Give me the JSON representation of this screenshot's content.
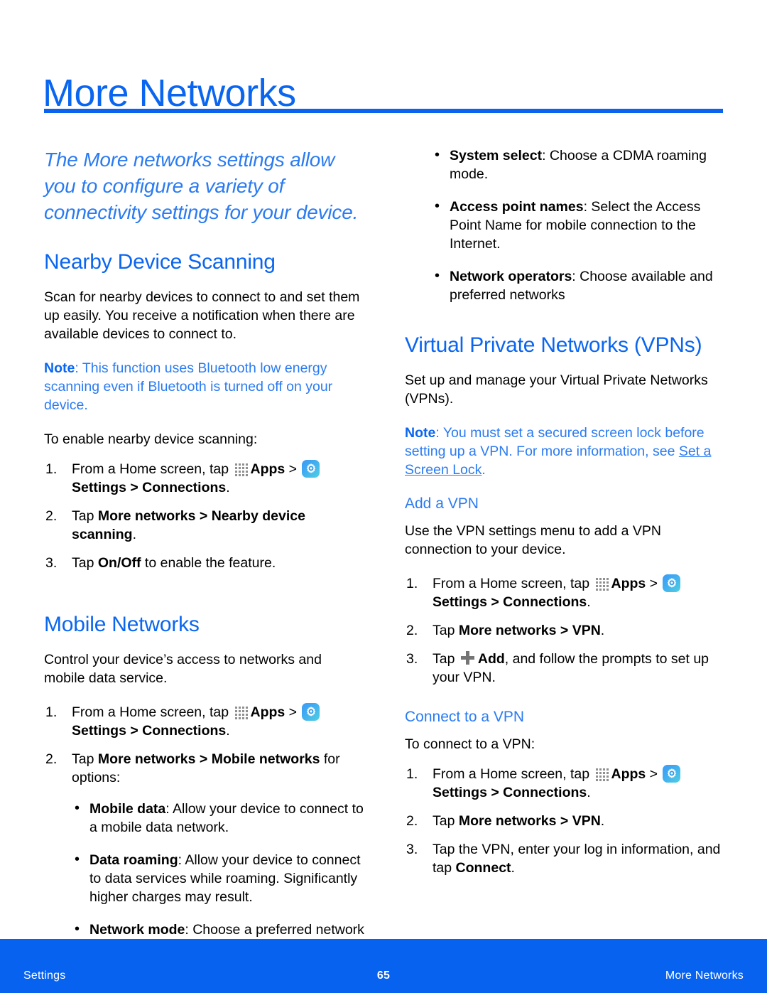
{
  "page": {
    "title": "More Networks",
    "accent_color": "#0a66f0",
    "note_color": "#2a7bf2",
    "footer_color": "#0862f0"
  },
  "intro": "The More networks settings allow you to configure a variety of connectivity settings for your device.",
  "left_column": {
    "nearby": {
      "heading": "Nearby Device Scanning",
      "body": "Scan for nearby devices to connect to and set them up easily. You receive a notification when there are available devices to connect to.",
      "note_label": "Note",
      "note_text": ": This function uses Bluetooth low energy scanning even if Bluetooth is turned off on your device.",
      "lead_in": "To enable nearby device scanning:",
      "steps": [
        {
          "pre": "From a Home screen, tap ",
          "apps": "Apps",
          "sep": " > ",
          "settings": "Settings",
          "post_bold": " > Connections",
          "post": "."
        },
        {
          "pre": "Tap ",
          "bold1": "More networks > Nearby device scanning",
          "post": "."
        },
        {
          "pre": "Tap ",
          "bold1": "On/Off",
          "post": " to enable the feature."
        }
      ]
    },
    "mobile": {
      "heading": "Mobile Networks",
      "body": "Control your device’s access to networks and mobile data service.",
      "steps": [
        {
          "pre": "From a Home screen, tap ",
          "apps": "Apps",
          "sep": " > ",
          "settings": "Settings",
          "post_bold": " > Connections",
          "post": "."
        },
        {
          "pre": "Tap ",
          "bold1": "More networks > Mobile networks",
          "post": " for options:"
        }
      ],
      "options": [
        {
          "term": "Mobile data",
          "desc": ": Allow your device to connect to a mobile data network."
        },
        {
          "term": "Data roaming",
          "desc": ": Allow your device to connect to data services while roaming. Significantly higher charges may result."
        },
        {
          "term": "Network mode",
          "desc": ": Choose a preferred network mode."
        }
      ]
    }
  },
  "right_column": {
    "continued_options": [
      {
        "term": "System select",
        "desc": ": Choose a CDMA roaming mode."
      },
      {
        "term": "Access point names",
        "desc": ": Select the Access Point Name for mobile connection to the Internet."
      },
      {
        "term": "Network operators",
        "desc": ": Choose available and preferred networks"
      }
    ],
    "vpn": {
      "heading": "Virtual Private Networks (VPNs)",
      "body": "Set up and manage your Virtual Private Networks (VPNs).",
      "note_label": "Note",
      "note_text": ": You must set a secured screen lock before setting up a VPN. For more information, see ",
      "note_link": "Set a Screen Lock",
      "note_end": ".",
      "add_vpn": {
        "heading": "Add a VPN",
        "body": "Use the VPN settings menu to add a VPN connection to your device.",
        "steps": [
          {
            "pre": "From a Home screen, tap ",
            "apps": "Apps",
            "sep": " > ",
            "settings": "Settings",
            "post_bold": " > Connections",
            "post": "."
          },
          {
            "pre": "Tap ",
            "bold1": "More networks > VPN",
            "post": "."
          },
          {
            "pre": "Tap ",
            "bold1": "Add",
            "post": ", and follow the prompts to set up your VPN."
          }
        ]
      },
      "connect_vpn": {
        "heading": "Connect to a VPN",
        "body": "To connect to a VPN:",
        "steps": [
          {
            "pre": "From a Home screen, tap ",
            "apps": "Apps",
            "sep": " > ",
            "settings": "Settings",
            "post_bold": " > Connections",
            "post": "."
          },
          {
            "pre": "Tap ",
            "bold1": "More networks > VPN",
            "post": "."
          },
          {
            "pre": "Tap the VPN, enter your log in information, and tap ",
            "bold1": "Connect",
            "post": "."
          }
        ]
      }
    }
  },
  "footer": {
    "left": "Settings",
    "page_number": "65",
    "right": "More Networks"
  }
}
